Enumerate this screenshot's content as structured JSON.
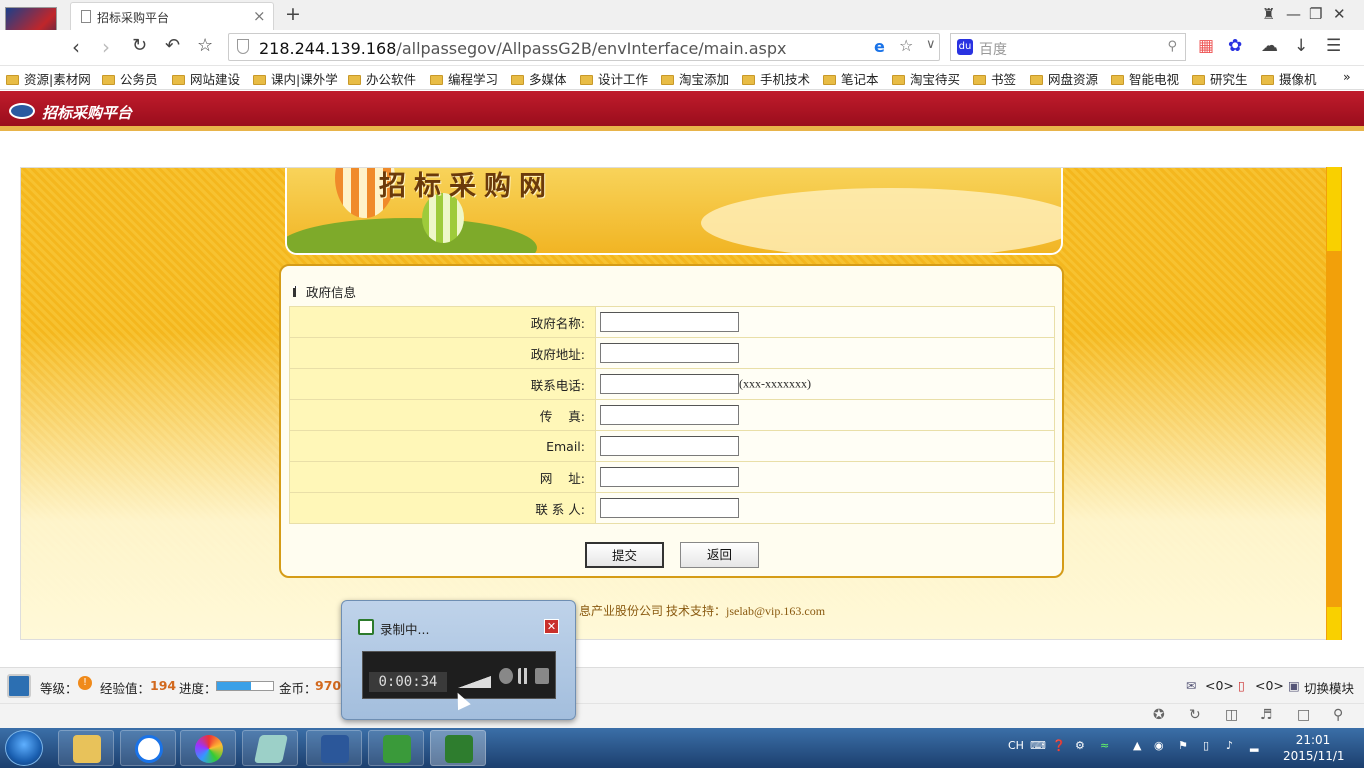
{
  "browser": {
    "tab_title": "招标采购平台",
    "tab_close": "×",
    "new_tab": "+",
    "url_host": "218.244.139.168",
    "url_path": "/allpassegov/AllpassG2B/envInterface/main.aspx",
    "search_placeholder": "百度",
    "bookmarks": [
      "资源|素材网",
      "公务员",
      "网站建设",
      "课内|课外学",
      "办公软件",
      "编程学习",
      "多媒体",
      "设计工作",
      "淘宝添加",
      "手机技术",
      "笔记本",
      "淘宝待买",
      "书签",
      "网盘资源",
      "智能电视",
      "研究生",
      "摄像机"
    ],
    "bookmarks_more": "»"
  },
  "site": {
    "header_name": "招标采购平台",
    "banner_title": "招标采购网",
    "panel_title": "政府信息",
    "form": [
      {
        "label": "政府名称:",
        "value": "",
        "hint": ""
      },
      {
        "label": "政府地址:",
        "value": "",
        "hint": ""
      },
      {
        "label": "联系电话:",
        "value": "",
        "hint": "(xxx-xxxxxxx)"
      },
      {
        "label": "传    真:",
        "value": "",
        "hint": ""
      },
      {
        "label": "Email:",
        "value": "",
        "hint": ""
      },
      {
        "label": "网    址:",
        "value": "",
        "hint": ""
      },
      {
        "label": "联 系 人:",
        "value": "",
        "hint": ""
      }
    ],
    "submit_label": "提交",
    "back_label": "返回",
    "footer_text": "息产业股份公司  技术支持：jselab@vip.163.com"
  },
  "status": {
    "level_label": "等级：",
    "exp_label": "经验值：",
    "exp_value": "194",
    "progress_label": "进度：",
    "progress_fraction": 0.6,
    "coins_label": "金币：",
    "coins_value": "970",
    "mail_count": "<0>",
    "msg_count": "<0>",
    "switch_label": "切换模块"
  },
  "recorder": {
    "title": "录制中...",
    "time": "0:00:34"
  },
  "taskbar": {
    "lang": "CH",
    "time": "21:01",
    "date": "2015/11/1"
  },
  "colors": {
    "header_red": "#b3192a",
    "panel_border": "#d59c17",
    "label_bg": "#fff7b8",
    "scrollbar": "#f2a00a"
  }
}
